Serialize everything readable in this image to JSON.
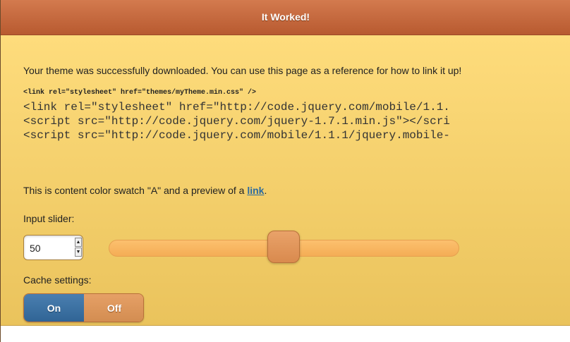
{
  "header": {
    "title": "It Worked!"
  },
  "intro": {
    "text": "Your theme was successfully downloaded. You can use this page as a reference for how to link it up!"
  },
  "code": {
    "small_line": "<link rel=\"stylesheet\" href=\"themes/myTheme.min.css\" />",
    "lines": [
      "<link rel=\"stylesheet\" href=\"http://code.jquery.com/mobile/1.1.",
      "<script src=\"http://code.jquery.com/jquery-1.7.1.min.js\"></scri",
      "<script src=\"http://code.jquery.com/mobile/1.1.1/jquery.mobile-"
    ]
  },
  "swatch": {
    "text_before": "This is content color swatch \"A\" and a preview of a ",
    "link_text": "link",
    "text_after": "."
  },
  "slider": {
    "label": "Input slider:",
    "value": "50",
    "spin_up": "▲",
    "spin_down": "▼",
    "level": 0.5
  },
  "cache": {
    "label": "Cache settings:",
    "on_label": "On",
    "off_label": "Off",
    "selected": "On"
  },
  "colors": {
    "header": "#c96a3e",
    "content_top": "#fedc7c",
    "content_bottom": "#eac35c",
    "link": "#2a6aa0",
    "toggle_on": "#3b70a2",
    "toggle_off": "#dc9658",
    "slider_track": "#f8b661"
  }
}
